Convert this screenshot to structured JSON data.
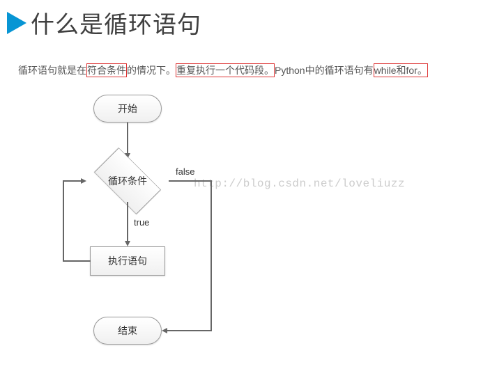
{
  "header": {
    "title": "什么是循环语句"
  },
  "description": {
    "part1": "循环语句就是在",
    "highlight1": "符合条件",
    "part2": "的情况下。",
    "highlight2": "重复执行一个代码段。",
    "part3": "Python中的循环语句有",
    "highlight3": "while和for。"
  },
  "flow": {
    "start": "开始",
    "condition": "循环条件",
    "true_label": "true",
    "false_label": "false",
    "body": "执行语句",
    "end": "结束"
  },
  "watermark": "http://blog.csdn.net/loveliuzz",
  "chart_data": {
    "type": "flowchart",
    "nodes": [
      {
        "id": "start",
        "type": "terminator",
        "label": "开始"
      },
      {
        "id": "cond",
        "type": "decision",
        "label": "循环条件"
      },
      {
        "id": "body",
        "type": "process",
        "label": "执行语句"
      },
      {
        "id": "end",
        "type": "terminator",
        "label": "结束"
      }
    ],
    "edges": [
      {
        "from": "start",
        "to": "cond",
        "label": ""
      },
      {
        "from": "cond",
        "to": "body",
        "label": "true"
      },
      {
        "from": "body",
        "to": "cond",
        "label": ""
      },
      {
        "from": "cond",
        "to": "end",
        "label": "false"
      }
    ]
  }
}
